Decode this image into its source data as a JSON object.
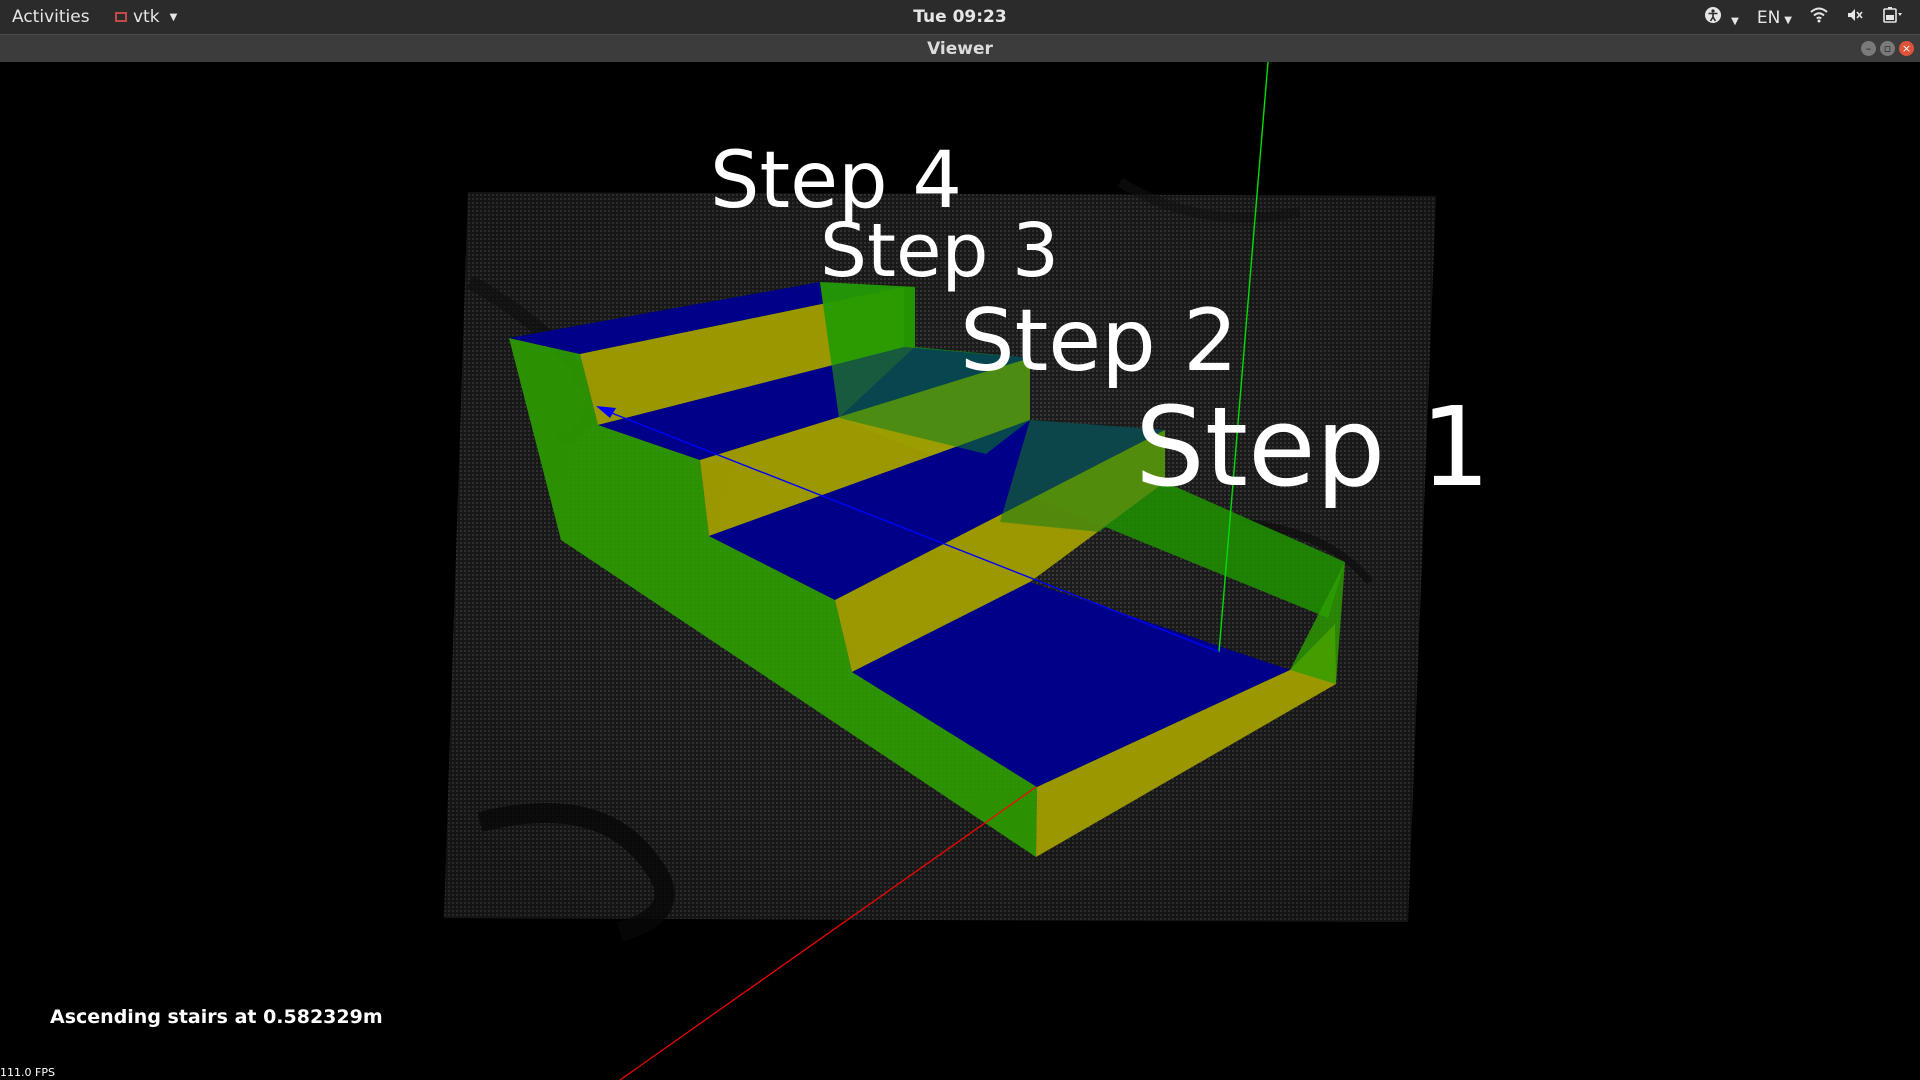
{
  "topbar": {
    "activities": "Activities",
    "app_name": "vtk",
    "clock": "Tue 09:23",
    "language": "EN",
    "icons": [
      "accessibility-icon",
      "wifi-icon",
      "volume-icon",
      "battery-icon"
    ]
  },
  "window": {
    "title": "Viewer"
  },
  "viewer": {
    "step_labels": [
      "Step 4",
      "Step 3",
      "Step 2",
      "Step 1"
    ],
    "status_text": "Ascending stairs at 0.582329m",
    "fps_text": "111.0 FPS"
  },
  "colors": {
    "riser": "#2e9f00",
    "tread": "#00008a",
    "front": "#9c9a00",
    "axis_x": "#ff0000",
    "axis_y": "#00ff00",
    "axis_z": "#0000ff"
  }
}
